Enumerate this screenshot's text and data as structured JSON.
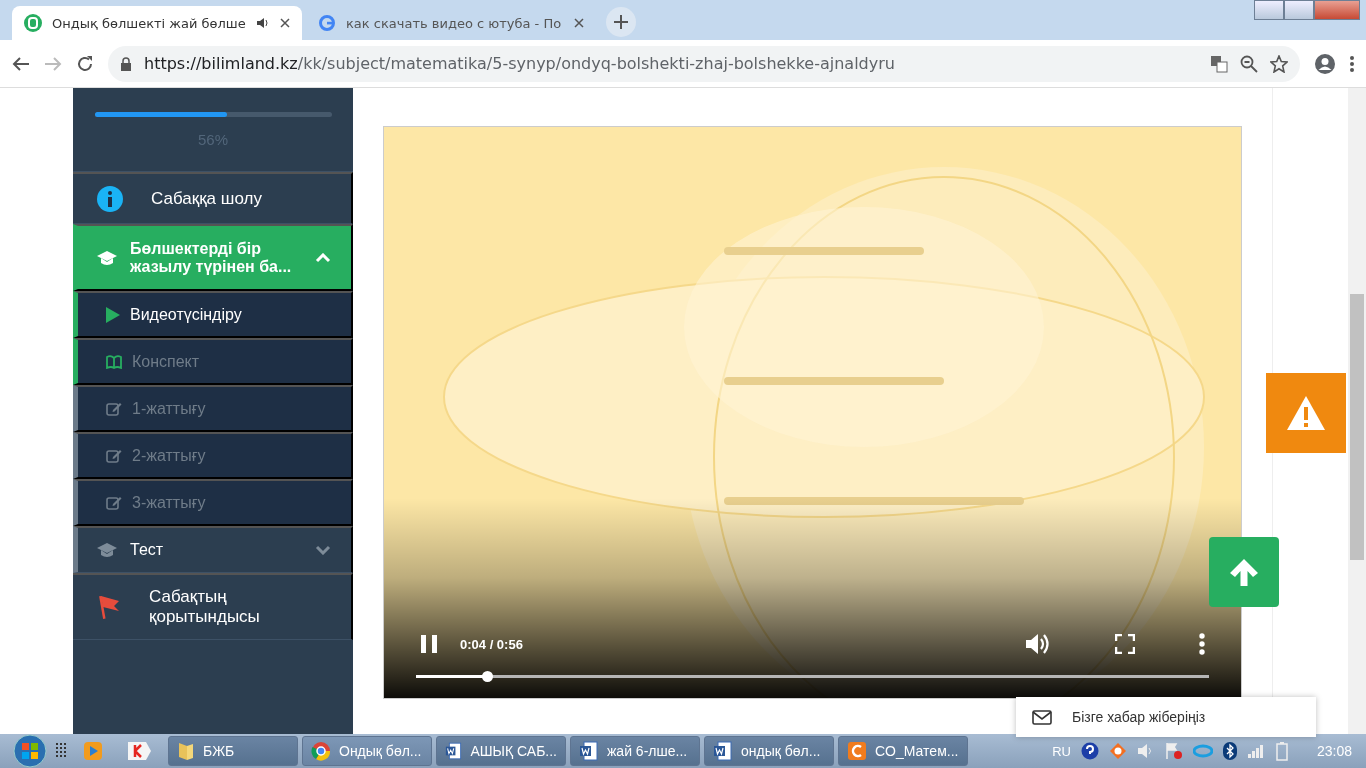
{
  "browser": {
    "tabs": [
      {
        "title": "Ондық бөлшекті жай бөлше",
        "selected": true,
        "audio": true,
        "kind": "site"
      },
      {
        "title": "как скачать видео с ютуба - По",
        "selected": false,
        "audio": false,
        "kind": "search"
      }
    ],
    "url": {
      "host": "https://bilimland.kz",
      "path": "/kk/subject/matematika/5-synyp/ondyq-bolshekti-zhaj-bolshekke-ajnaldyru"
    }
  },
  "sidebar": {
    "progress": {
      "level": 0.56,
      "label": "56%"
    },
    "items": [
      {
        "kind": "info",
        "label": "Сабаққа шолу"
      },
      {
        "kind": "section",
        "label": "Бөлшектерді бір жазылу түрінен ба...",
        "expanded": true,
        "selected": true,
        "children": [
          {
            "kind": "video",
            "label": "Видеотүсіндіру",
            "selected": true,
            "visited": true
          },
          {
            "kind": "notes",
            "label": "Конспект",
            "selected": false,
            "visited": true
          },
          {
            "kind": "exercise",
            "label": "1-жаттығу",
            "selected": false,
            "visited": false
          },
          {
            "kind": "exercise",
            "label": "2-жаттығу",
            "selected": false,
            "visited": false
          },
          {
            "kind": "exercise",
            "label": "3-жаттығу",
            "selected": false,
            "visited": false
          }
        ]
      },
      {
        "kind": "section",
        "label": "Тест",
        "expanded": false,
        "selected": false
      },
      {
        "kind": "flag",
        "label": "Сабақтың қорытындысы"
      }
    ]
  },
  "video": {
    "kind": "picture",
    "playing": true,
    "time": "0:04 / 0:56",
    "level": 0.09
  },
  "feedback": {
    "label": "Бізге хабар жіберіңіз"
  },
  "taskbar": {
    "items": [
      {
        "kind": "folder",
        "label": "БЖБ",
        "selected": false
      },
      {
        "kind": "chrome",
        "label": "Ондық бөл...",
        "selected": true
      },
      {
        "kind": "word",
        "label": "АШЫҚ САБ...",
        "selected": false
      },
      {
        "kind": "word",
        "label": "жай 6-лше...",
        "selected": false
      },
      {
        "kind": "word",
        "label": "ондық бөл...",
        "selected": false
      },
      {
        "kind": "foxit",
        "label": "CO_Матем...",
        "selected": false
      }
    ],
    "lang": "RU",
    "clock": "23:08"
  }
}
